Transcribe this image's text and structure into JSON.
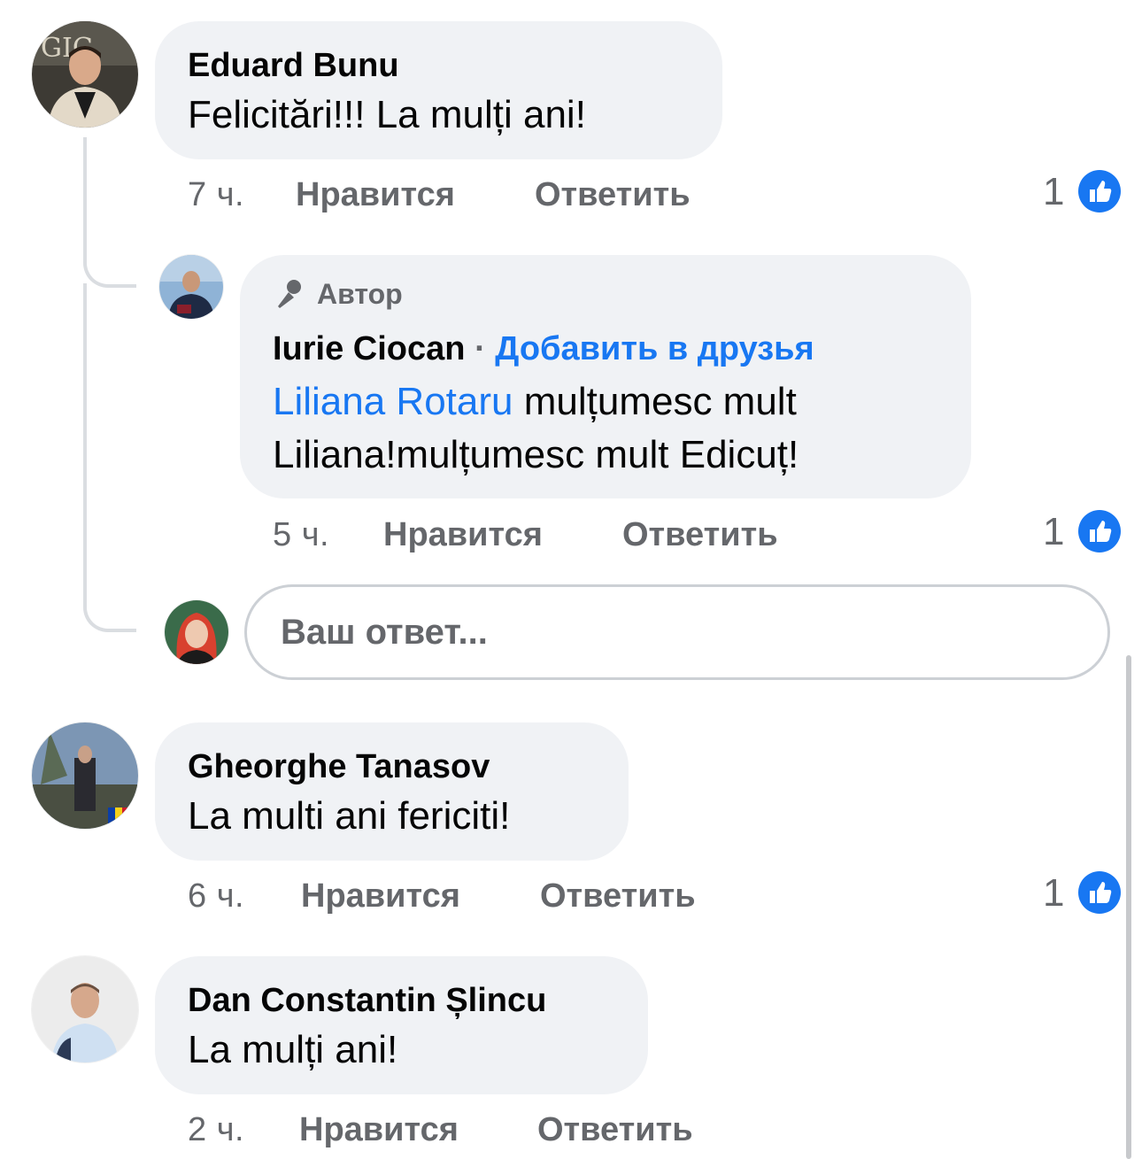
{
  "colors": {
    "bubble": "#f0f2f5",
    "meta_text": "#65676b",
    "link_blue": "#1877f2",
    "like_blue": "#1877f2"
  },
  "comments": [
    {
      "author": "Eduard Bunu",
      "text": "Felicitări!!! La mulți ani!",
      "time": "7 ч.",
      "like_label": "Нравится",
      "reply_label": "Ответить",
      "likes": "1",
      "avatar_icon": "eduard-bunu-avatar"
    },
    {
      "author": "Gheorghe Tanasov",
      "text": "La multi ani fericiti!",
      "time": "6 ч.",
      "like_label": "Нравится",
      "reply_label": "Ответить",
      "likes": "1",
      "avatar_icon": "gheorghe-tanasov-avatar"
    },
    {
      "author": "Dan Constantin Șlincu",
      "text": "La mulți ani!",
      "time": "2 ч.",
      "like_label": "Нравится",
      "reply_label": "Ответить",
      "avatar_icon": "dan-constantin-slincu-avatar"
    }
  ],
  "reply": {
    "author_badge": "Автор",
    "author": "Iurie Ciocan",
    "separator": "·",
    "add_friend": "Добавить в друзья",
    "mention": "Liliana Rotaru",
    "text_line1": " mulțumesc mult",
    "text_line2": "Liliana!mulțumesc mult Edicuț!",
    "time": "5 ч.",
    "like_label": "Нравится",
    "reply_label": "Ответить",
    "likes": "1",
    "avatar_icon": "iurie-ciocan-avatar"
  },
  "reply_box": {
    "placeholder": "Ваш ответ...",
    "avatar_icon": "current-user-avatar"
  }
}
